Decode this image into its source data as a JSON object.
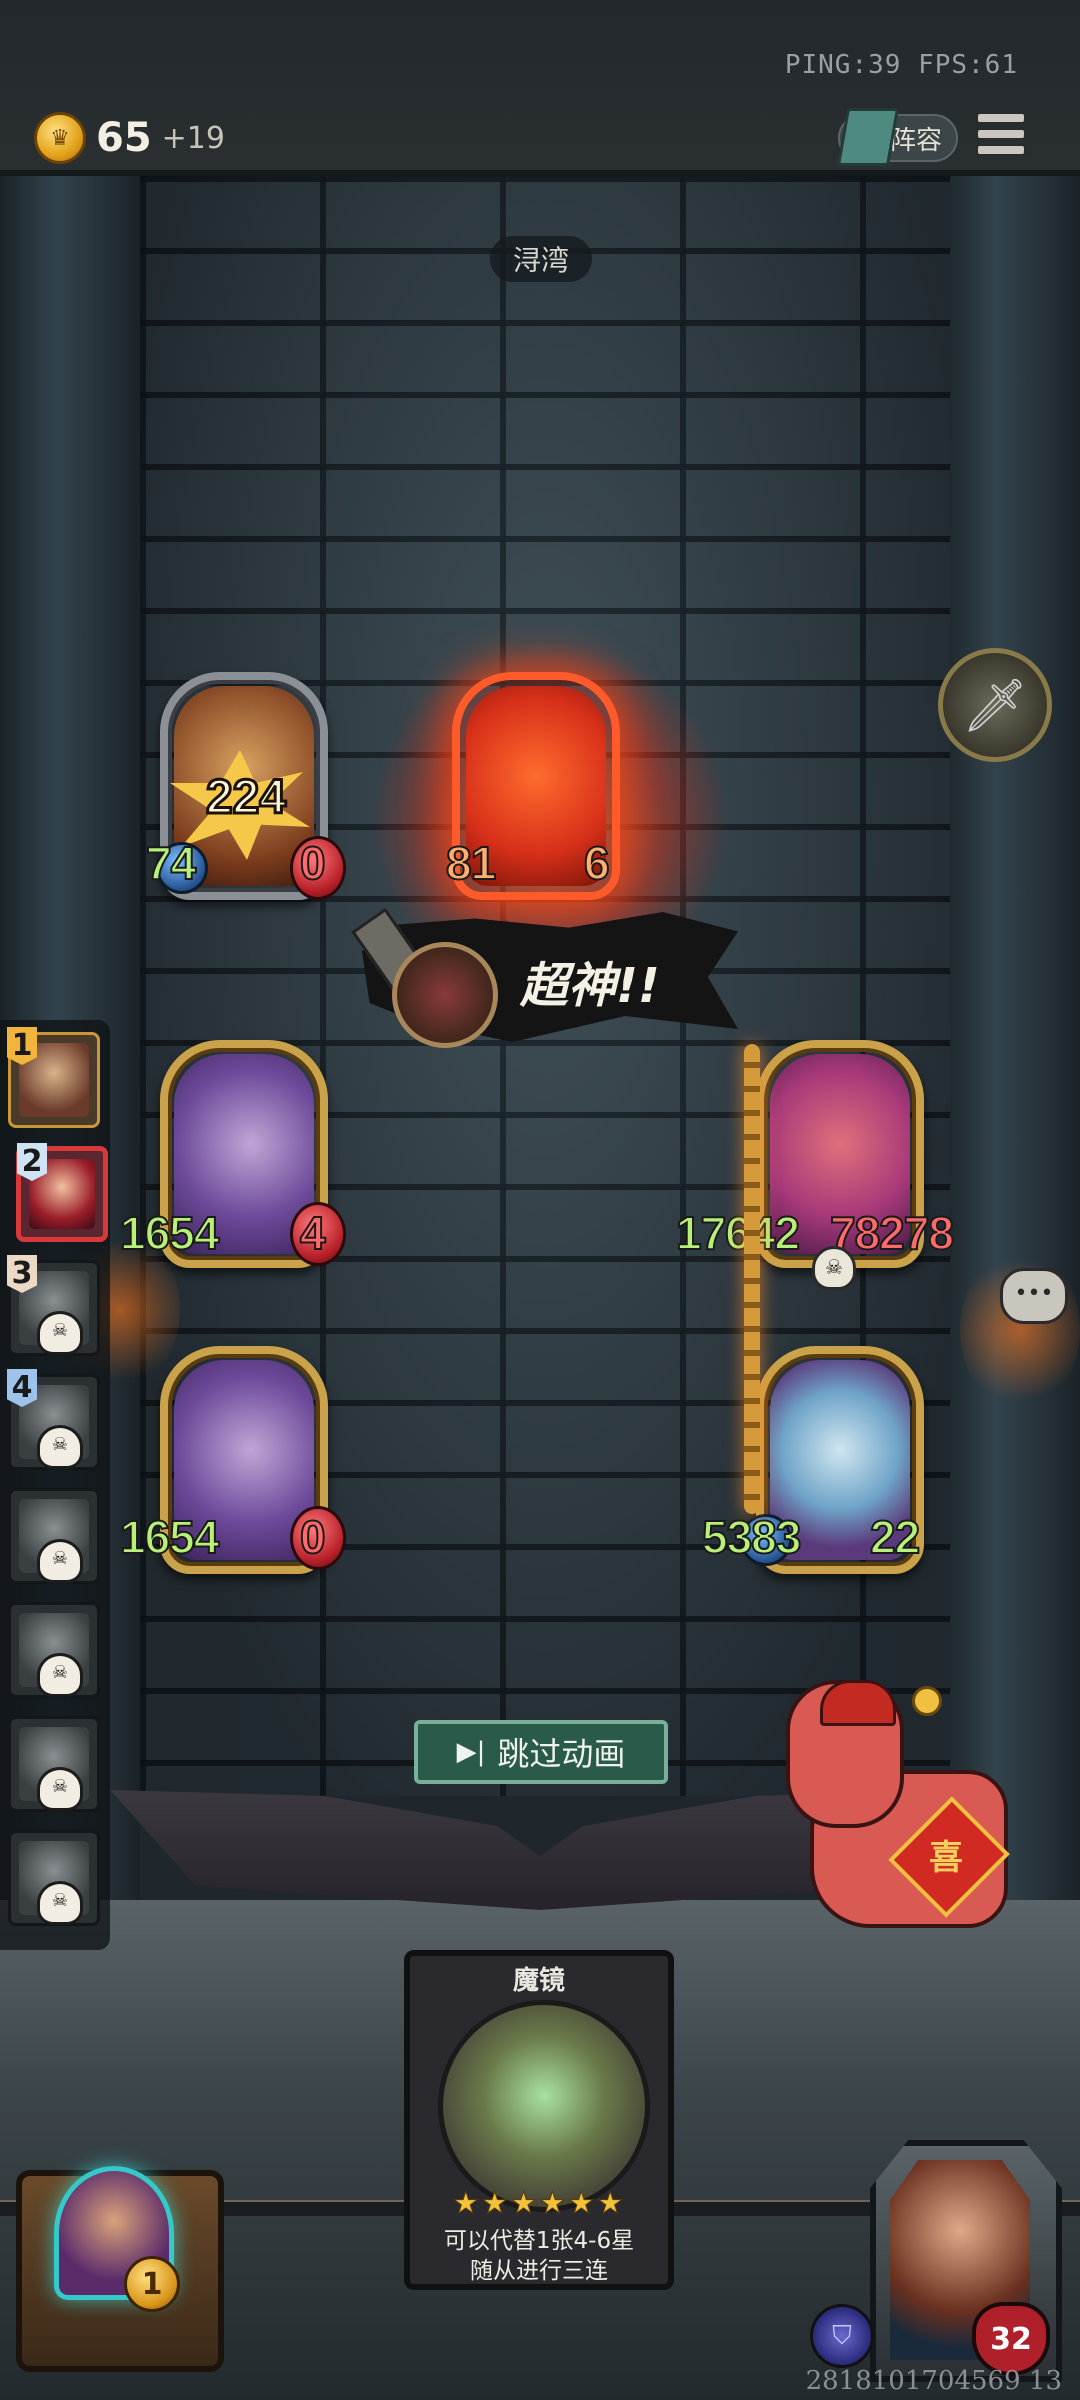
{
  "hud": {
    "net_stats": "PING:39   FPS:61",
    "gold": "65",
    "gold_bonus": "+19",
    "lineup_label": "阵容"
  },
  "board": {
    "location": "浔湾",
    "enemy_row": [
      {
        "name": "guard",
        "atk": "74",
        "hp": "0",
        "damage": "224"
      },
      {
        "name": "fire-demon",
        "atk": "81",
        "hp": "6"
      }
    ],
    "player_row1": [
      {
        "name": "dark-dragon",
        "atk": "1654",
        "hp": "4"
      },
      {
        "name": "red-dragon",
        "atk": "17642",
        "hp": "78278"
      }
    ],
    "player_row2": [
      {
        "name": "dark-dragon",
        "atk": "1654",
        "hp": "0"
      },
      {
        "name": "blue-dragon",
        "atk": "5383",
        "hp": "22"
      }
    ],
    "banner_text": "超神!!"
  },
  "roster": {
    "ranks": [
      "1",
      "2",
      "3",
      "4"
    ]
  },
  "controls": {
    "skip_label": "跳过动画"
  },
  "pet": {
    "tag_char": "喜"
  },
  "spell_card": {
    "title": "魔镜",
    "stars": "★★★★★★",
    "desc_line1": "可以代替1张4-6星",
    "desc_line2": "随从进行三连"
  },
  "player": {
    "level": "1",
    "health": "32",
    "uid": "2818101704569 13"
  }
}
